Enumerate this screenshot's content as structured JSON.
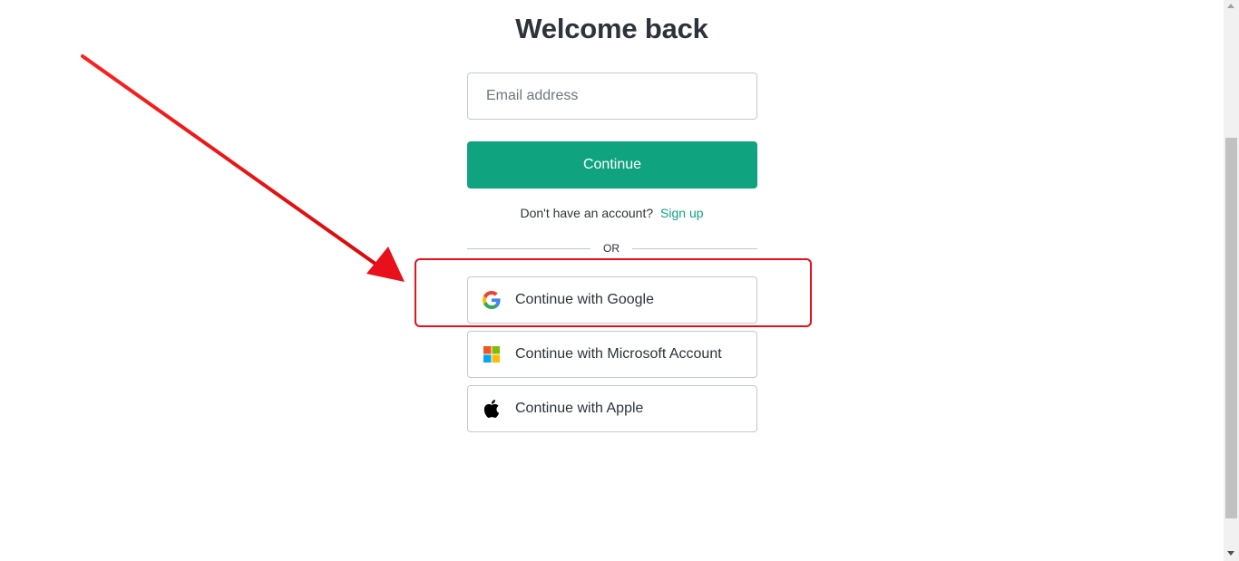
{
  "header": {
    "title": "Welcome back"
  },
  "form": {
    "email_placeholder": "Email address",
    "email_value": "",
    "continue_label": "Continue",
    "no_account_text": "Don't have an account?",
    "signup_label": "Sign up",
    "divider_text": "OR"
  },
  "social": {
    "google_label": "Continue with Google",
    "microsoft_label": "Continue with Microsoft Account",
    "apple_label": "Continue with Apple"
  },
  "colors": {
    "accent": "#10a37f",
    "annotation": "#e8101a",
    "text": "#2d333a",
    "border": "#c2c8d0"
  },
  "icons": {
    "google": "google-icon",
    "microsoft": "microsoft-icon",
    "apple": "apple-icon"
  }
}
